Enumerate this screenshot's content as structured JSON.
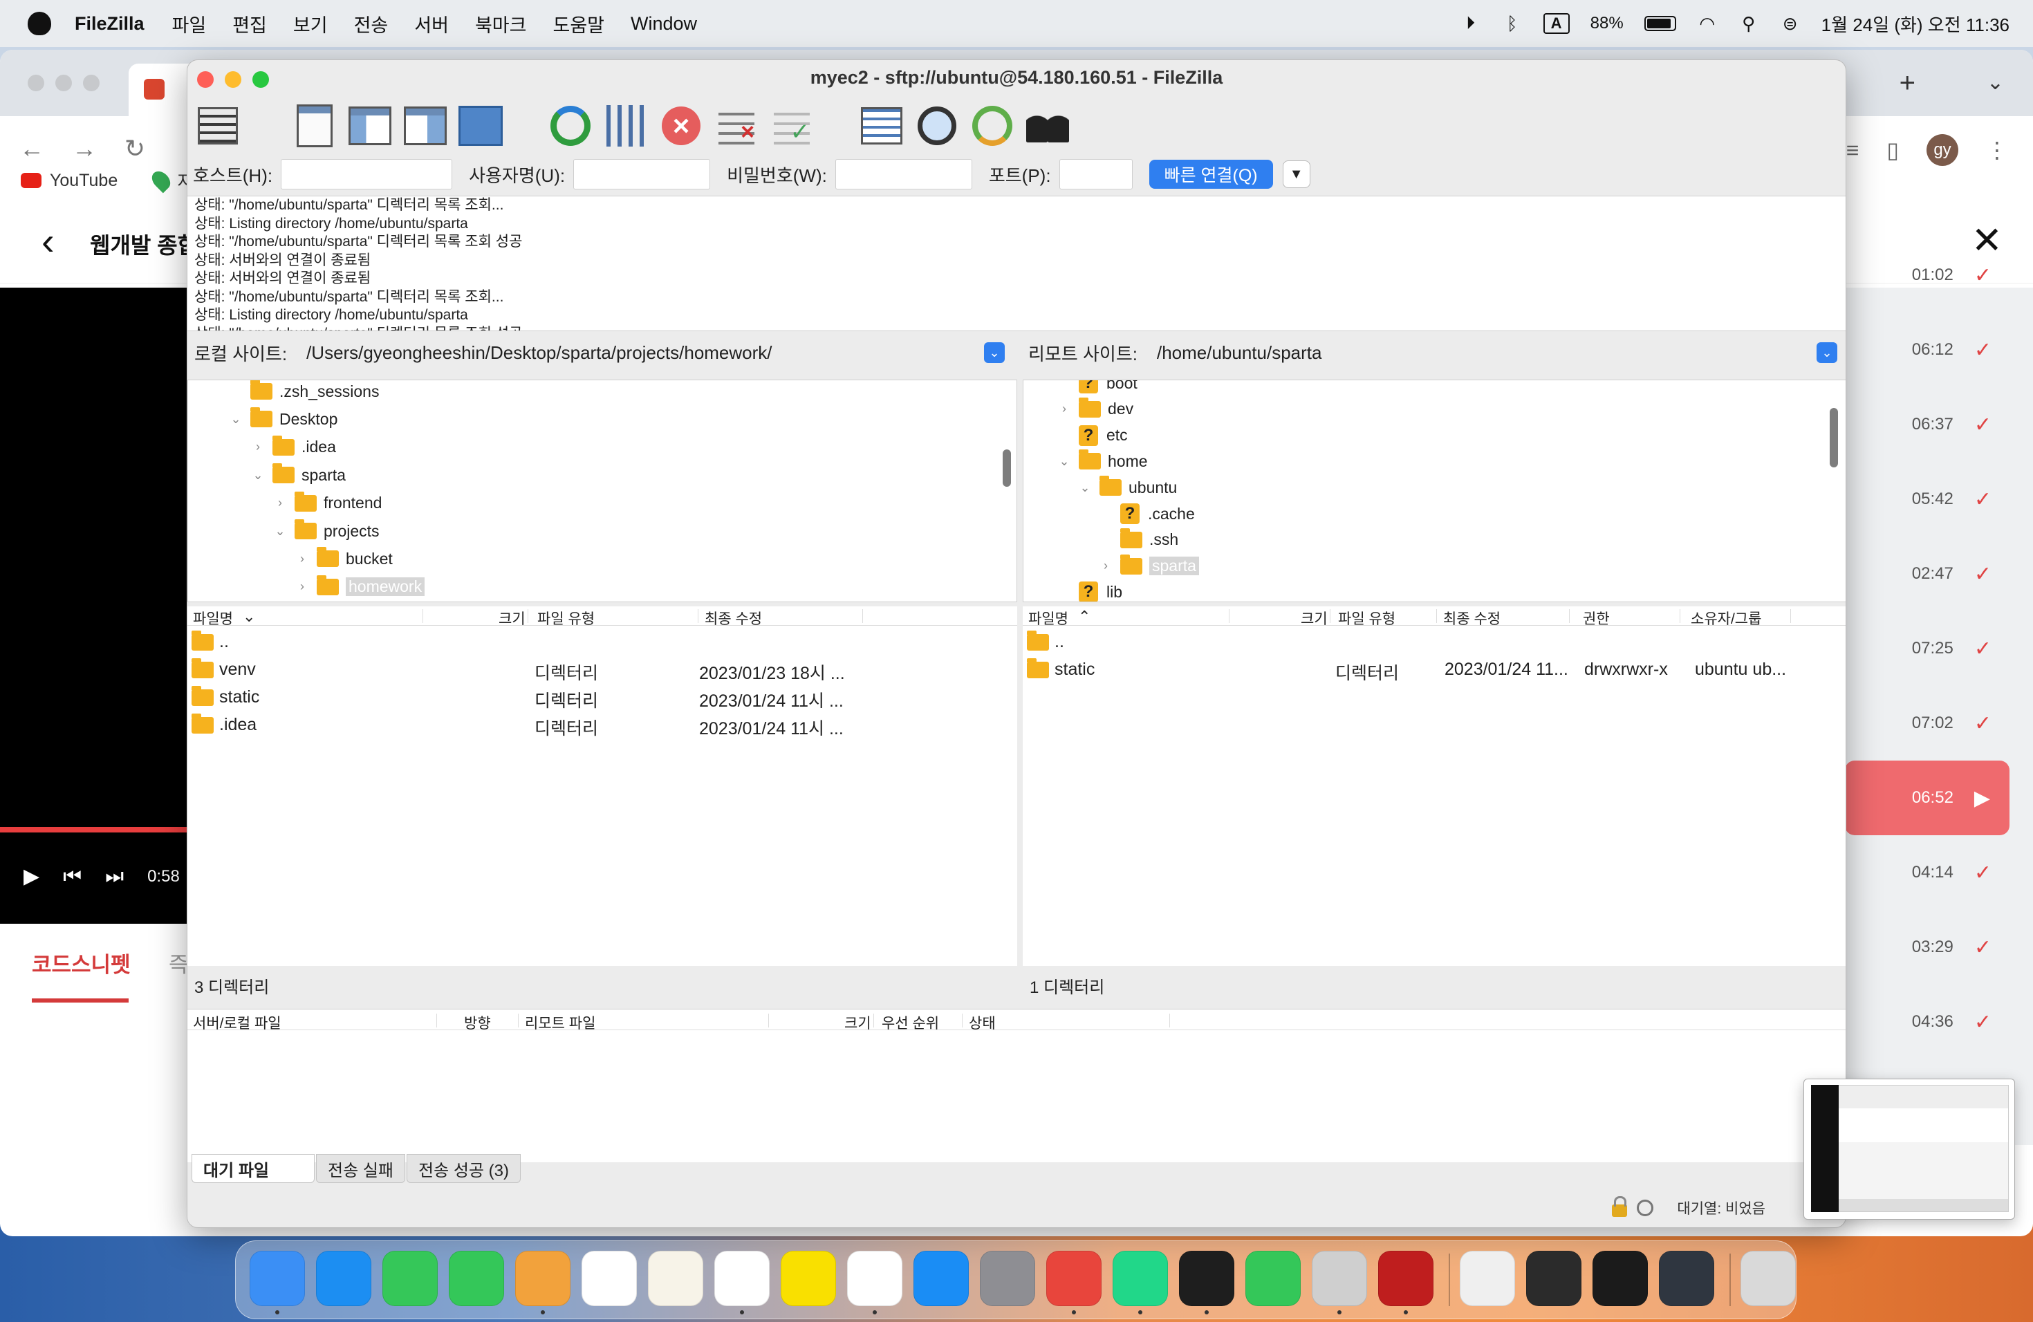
{
  "menubar": {
    "app_name": "FileZilla",
    "menus": [
      "파일",
      "편집",
      "보기",
      "전송",
      "서버",
      "북마크",
      "도움말",
      "Window"
    ],
    "battery_percent": "88%",
    "input_indicator": "A",
    "datetime": "1월 24일 (화) 오전 11:36"
  },
  "browser": {
    "bookmarks": [
      "YouTube",
      "지"
    ],
    "page_title": "웹개발 종합",
    "avatar_text": "gy",
    "video_time": "0:58",
    "tab_snippet": "코드스니펫",
    "tab_other": "즉",
    "lessons": [
      {
        "time": "01:02",
        "active": false
      },
      {
        "time": "06:12",
        "active": false
      },
      {
        "time": "06:37",
        "active": false
      },
      {
        "time": "05:42",
        "active": false
      },
      {
        "time": "02:47",
        "active": false
      },
      {
        "time": "07:25",
        "active": false
      },
      {
        "time": "07:02",
        "active": false
      },
      {
        "time": "06:52",
        "active": true
      },
      {
        "time": "04:14",
        "active": false
      },
      {
        "time": "03:29",
        "active": false
      },
      {
        "time": "04:36",
        "active": false
      }
    ]
  },
  "filezilla": {
    "window_title": "myec2 - sftp://ubuntu@54.180.160.51 - FileZilla",
    "toolbar_icons": [
      "site-manager-icon",
      "message-log-icon",
      "local-tree-icon",
      "remote-tree-icon",
      "transfer-queue-icon",
      "refresh-icon",
      "filter-icon",
      "cancel-icon",
      "disconnect-icon",
      "reconnect-icon",
      "directory-listing-icon",
      "search-files-icon",
      "compare-icon",
      "binoculars-icon"
    ],
    "quickconnect": {
      "host_label": "호스트(H):",
      "user_label": "사용자명(U):",
      "pass_label": "비밀번호(W):",
      "port_label": "포트(P):",
      "host_value": "",
      "user_value": "",
      "pass_value": "",
      "port_value": "",
      "connect_button": "빠른 연결(Q)"
    },
    "log": [
      "상태:  \"/home/ubuntu/sparta\" 디렉터리 목록 조회...",
      "상태:  Listing directory /home/ubuntu/sparta",
      "상태:  \"/home/ubuntu/sparta\" 디렉터리 목록 조회 성공",
      "상태:  서버와의 연결이 종료됨",
      "상태:  서버와의 연결이 종료됨",
      "상태:  \"/home/ubuntu/sparta\" 디렉터리 목록 조회...",
      "상태:  Listing directory /home/ubuntu/sparta",
      "상태:  \"/home/ubuntu/sparta\" 디렉터리 목록 조회 성공"
    ],
    "local": {
      "label": "로컬 사이트:",
      "path": "/Users/gyeongheeshin/Desktop/sparta/projects/homework/",
      "tree": [
        {
          "name": ".zsh_sessions",
          "depth": 0,
          "arrow": ""
        },
        {
          "name": "Desktop",
          "depth": 0,
          "arrow": "⌄"
        },
        {
          "name": ".idea",
          "depth": 1,
          "arrow": "›"
        },
        {
          "name": "sparta",
          "depth": 1,
          "arrow": "⌄"
        },
        {
          "name": "frontend",
          "depth": 2,
          "arrow": "›"
        },
        {
          "name": "projects",
          "depth": 2,
          "arrow": "⌄"
        },
        {
          "name": "bucket",
          "depth": 3,
          "arrow": "›"
        },
        {
          "name": "homework",
          "depth": 3,
          "arrow": "›",
          "selected": true
        }
      ],
      "columns": [
        "파일명",
        "크기",
        "파일 유형",
        "최종 수정"
      ],
      "files": [
        {
          "name": "..",
          "type": "",
          "modified": ""
        },
        {
          "name": "venv",
          "type": "디렉터리",
          "modified": "2023/01/23 18시 ..."
        },
        {
          "name": "static",
          "type": "디렉터리",
          "modified": "2023/01/24 11시 ..."
        },
        {
          "name": ".idea",
          "type": "디렉터리",
          "modified": "2023/01/24 11시 ..."
        }
      ],
      "status": "3 디렉터리"
    },
    "remote": {
      "label": "리모트 사이트:",
      "path": "/home/ubuntu/sparta",
      "tree": [
        {
          "name": "boot",
          "depth": 0,
          "arrow": "",
          "icon": "question"
        },
        {
          "name": "dev",
          "depth": 0,
          "arrow": "›",
          "icon": "folder"
        },
        {
          "name": "etc",
          "depth": 0,
          "arrow": "",
          "icon": "question"
        },
        {
          "name": "home",
          "depth": 0,
          "arrow": "⌄",
          "icon": "folder"
        },
        {
          "name": "ubuntu",
          "depth": 1,
          "arrow": "⌄",
          "icon": "folder"
        },
        {
          "name": ".cache",
          "depth": 2,
          "arrow": "",
          "icon": "question"
        },
        {
          "name": ".ssh",
          "depth": 2,
          "arrow": "",
          "icon": "folder"
        },
        {
          "name": "sparta",
          "depth": 2,
          "arrow": "›",
          "icon": "folder",
          "selected": true
        },
        {
          "name": "lib",
          "depth": 0,
          "arrow": "",
          "icon": "question"
        }
      ],
      "columns": [
        "파일명",
        "크기",
        "파일 유형",
        "최종 수정",
        "권한",
        "소유자/그룹"
      ],
      "files": [
        {
          "name": "..",
          "type": "",
          "modified": "",
          "perm": "",
          "owner": ""
        },
        {
          "name": "static",
          "type": "디렉터리",
          "modified": "2023/01/24 11...",
          "perm": "drwxrwxr-x",
          "owner": "ubuntu ub..."
        }
      ],
      "status": "1 디렉터리"
    },
    "queue": {
      "columns": [
        "서버/로컬 파일",
        "방향",
        "리모트 파일",
        "크기",
        "우선 순위",
        "상태"
      ],
      "tabs": [
        "대기 파일",
        "전송 실패",
        "전송 성공 (3)"
      ]
    },
    "status_bar": "대기열: 비었음"
  }
}
